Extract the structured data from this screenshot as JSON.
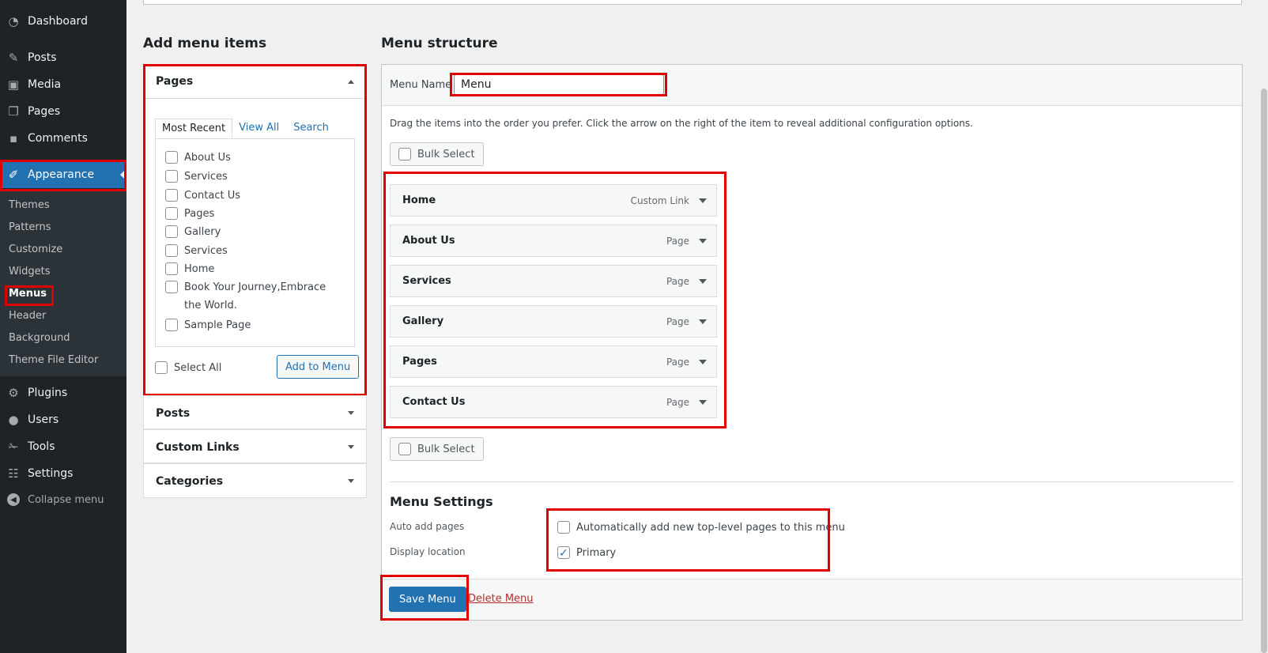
{
  "sidebar": {
    "items": [
      {
        "label": "Dashboard",
        "icon": "dashboard-icon"
      },
      {
        "label": "Posts",
        "icon": "pin-icon"
      },
      {
        "label": "Media",
        "icon": "media-icon"
      },
      {
        "label": "Pages",
        "icon": "pages-icon"
      },
      {
        "label": "Comments",
        "icon": "comment-icon"
      },
      {
        "label": "Appearance",
        "icon": "brush-icon"
      },
      {
        "label": "Plugins",
        "icon": "plugin-icon"
      },
      {
        "label": "Users",
        "icon": "user-icon"
      },
      {
        "label": "Tools",
        "icon": "wrench-icon"
      },
      {
        "label": "Settings",
        "icon": "settings-icon"
      }
    ],
    "submenu": [
      "Themes",
      "Patterns",
      "Customize",
      "Widgets",
      "Menus",
      "Header",
      "Background",
      "Theme File Editor"
    ],
    "collapse_label": "Collapse menu"
  },
  "add_items": {
    "heading": "Add menu items",
    "pages_title": "Pages",
    "tabs": [
      "Most Recent",
      "View All",
      "Search"
    ],
    "pages": [
      "About Us",
      "Services",
      "Contact Us",
      "Pages",
      "Gallery",
      "Services",
      "Home",
      "Book Your Journey,Embrace the World.",
      "Sample Page"
    ],
    "select_all": "Select All",
    "add_button": "Add to Menu",
    "other_sections": [
      "Posts",
      "Custom Links",
      "Categories"
    ]
  },
  "structure": {
    "heading": "Menu structure",
    "menu_name_label": "Menu Name",
    "menu_name_value": "Menu",
    "instructions": "Drag the items into the order you prefer. Click the arrow on the right of the item to reveal additional configuration options.",
    "bulk_select": "Bulk Select",
    "items": [
      {
        "title": "Home",
        "type": "Custom Link"
      },
      {
        "title": "About Us",
        "type": "Page"
      },
      {
        "title": "Services",
        "type": "Page"
      },
      {
        "title": "Gallery",
        "type": "Page"
      },
      {
        "title": "Pages",
        "type": "Page"
      },
      {
        "title": "Contact Us",
        "type": "Page"
      }
    ],
    "settings_heading": "Menu Settings",
    "auto_add_label": "Auto add pages",
    "auto_add_option": "Automatically add new top-level pages to this menu",
    "display_location_label": "Display location",
    "display_location_option": "Primary",
    "save_button": "Save Menu",
    "delete_link": "Delete Menu"
  },
  "colors": {
    "highlight": "#e00000",
    "accent": "#2271b1",
    "sidebar_bg": "#1d2327"
  }
}
